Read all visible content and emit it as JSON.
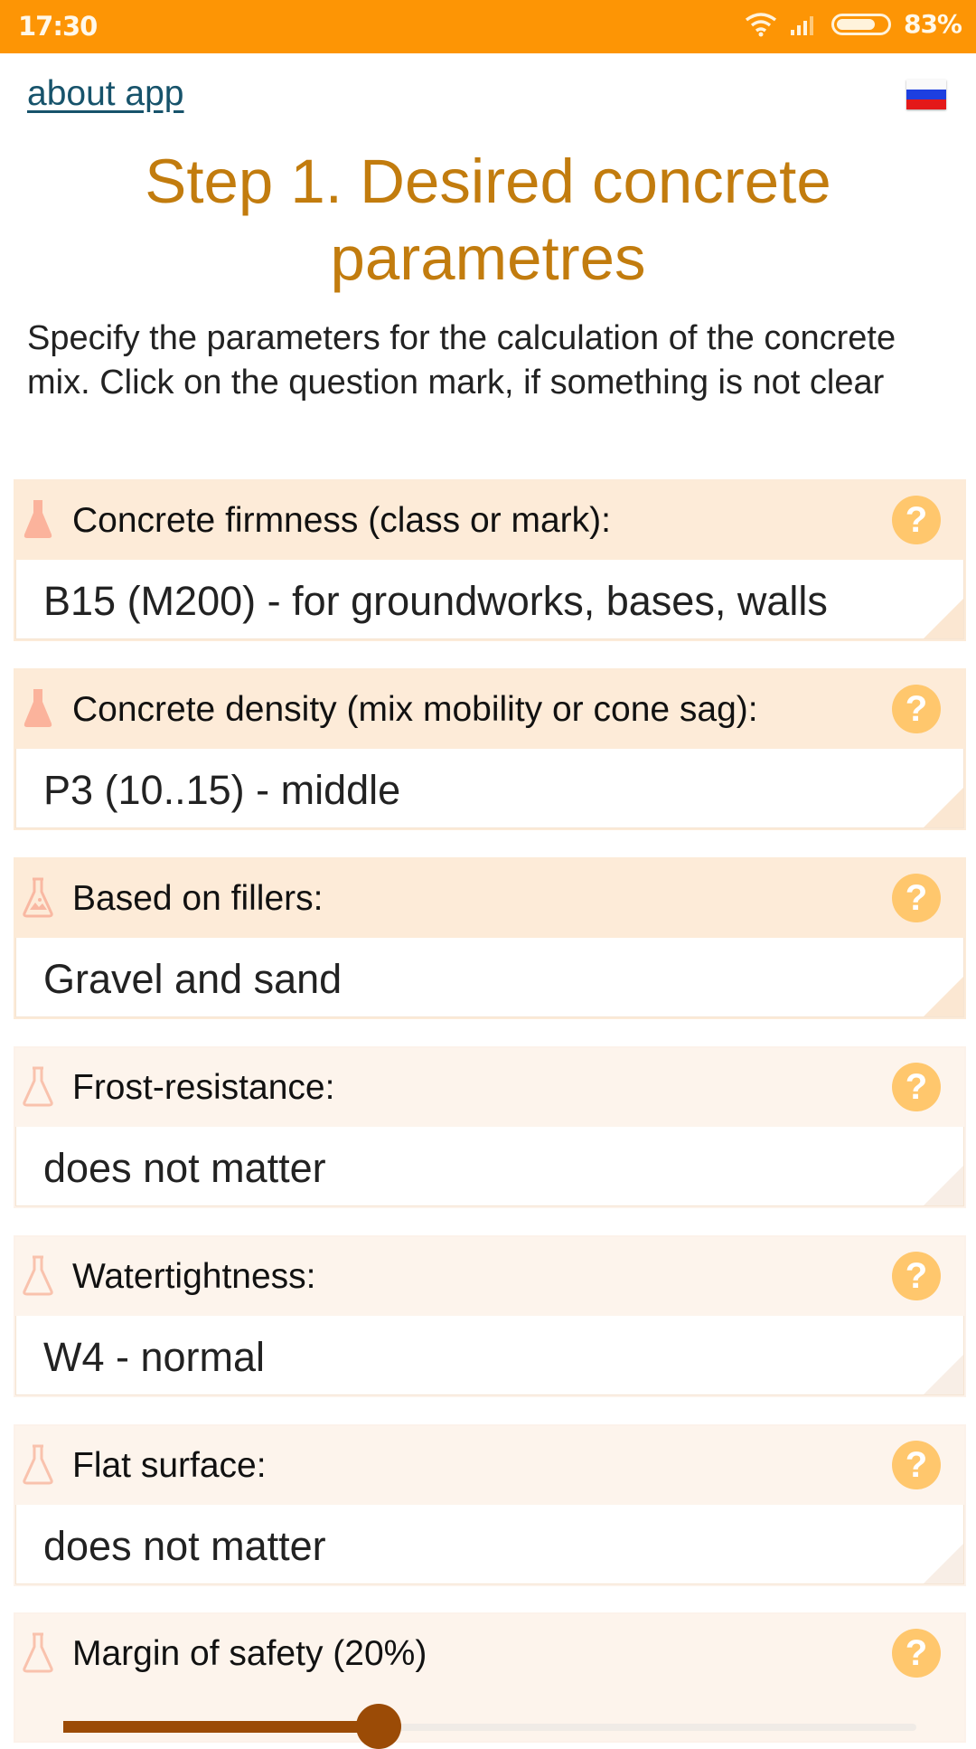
{
  "status_bar": {
    "time": "17:30",
    "battery": "83%",
    "battery_level": 0.83
  },
  "header": {
    "about_link": "about app",
    "language_flag": "russian-flag-icon"
  },
  "title": "Step 1. Desired concrete parametres",
  "intro": "Specify the parameters for the calculation of the concrete mix. Click on the question mark, if something is not clear",
  "fields": [
    {
      "label": "Concrete firmness (class or mark):",
      "value": "B15 (M200) - for groundworks, bases, walls",
      "icon": "flask-filled-icon"
    },
    {
      "label": "Concrete density (mix mobility or cone sag):",
      "value": "P3 (10..15) - middle",
      "icon": "flask-filled-icon"
    },
    {
      "label": "Based on fillers:",
      "value": "Gravel and sand",
      "icon": "flask-picture-icon"
    },
    {
      "label": "Frost-resistance:",
      "value": "does not matter",
      "icon": "flask-outline-icon"
    },
    {
      "label": "Watertightness:",
      "value": "W4 - normal",
      "icon": "flask-outline-icon"
    },
    {
      "label": "Flat surface:",
      "value": "does not matter",
      "icon": "flask-outline-icon"
    }
  ],
  "help_symbol": "?",
  "safety": {
    "label": "Margin of safety (20%)",
    "value_percent": 20,
    "slider_fraction": 0.37
  },
  "colors": {
    "status_bar": "#fd9505",
    "title": "#c27c0e",
    "slider": "#9b4b06",
    "help": "#ffc76d",
    "link": "#17536b"
  }
}
